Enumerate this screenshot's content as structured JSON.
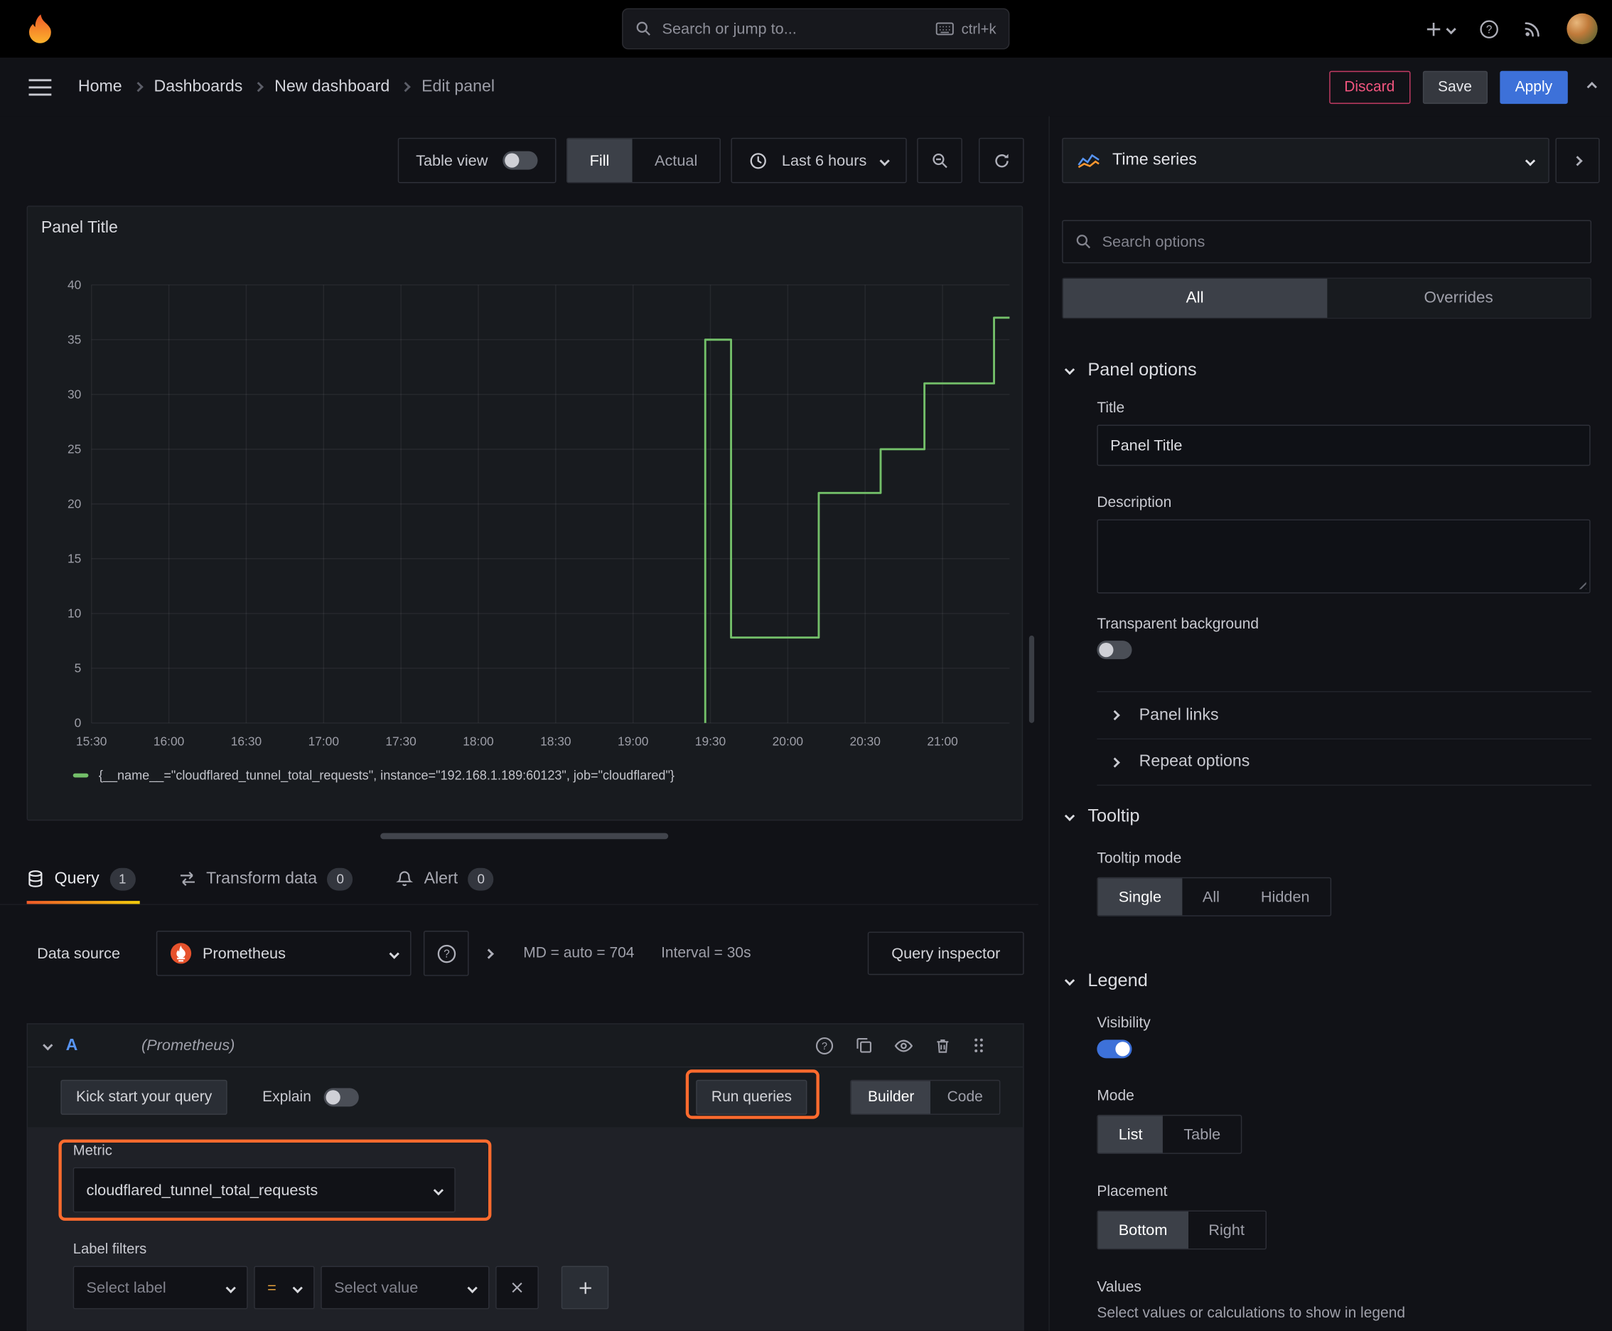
{
  "colors": {
    "accent_orange": "#ff780a",
    "annotation_highlight": "#ff6b2e",
    "primary_blue": "#3d71d9",
    "series_green": "#73bf69",
    "destructive_red": "#f2557f"
  },
  "topbar": {
    "search_placeholder": "Search or jump to...",
    "shortcut": "ctrl+k"
  },
  "breadcrumb": {
    "items": [
      "Home",
      "Dashboards",
      "New dashboard",
      "Edit panel"
    ],
    "discard_label": "Discard",
    "save_label": "Save",
    "apply_label": "Apply"
  },
  "panel_toolbar": {
    "table_view_label": "Table view",
    "table_view_on": false,
    "fill_label": "Fill",
    "actual_label": "Actual",
    "fill_selected": true,
    "time_range_label": "Last 6 hours"
  },
  "chart_data": {
    "type": "line",
    "title": "Panel Title",
    "x_ticks": [
      "15:30",
      "16:00",
      "16:30",
      "17:00",
      "17:30",
      "18:00",
      "18:30",
      "19:00",
      "19:30",
      "20:00",
      "20:30",
      "21:00"
    ],
    "x_tick_interval_min": 30,
    "x_range_minutes": [
      0,
      356
    ],
    "ylim": [
      0,
      40
    ],
    "y_ticks": [
      0,
      5,
      10,
      15,
      20,
      25,
      30,
      35,
      40
    ],
    "grid": true,
    "legend_position": "bottom",
    "series": [
      {
        "name": "{__name__=\"cloudflared_tunnel_total_requests\", instance=\"192.168.1.189:60123\", job=\"cloudflared\"}",
        "color": "#73bf69",
        "points_minutes_value": [
          [
            238,
            0
          ],
          [
            238,
            35
          ],
          [
            248,
            35
          ],
          [
            248,
            7.8
          ],
          [
            282,
            7.8
          ],
          [
            282,
            21
          ],
          [
            306,
            21
          ],
          [
            306,
            25
          ],
          [
            323,
            25
          ],
          [
            323,
            31
          ],
          [
            350,
            31
          ],
          [
            350,
            37
          ],
          [
            356,
            37
          ]
        ]
      }
    ]
  },
  "tabs": {
    "query_label": "Query",
    "query_count": "1",
    "transform_label": "Transform data",
    "transform_count": "0",
    "alert_label": "Alert",
    "alert_count": "0"
  },
  "query": {
    "datasource_label": "Data source",
    "datasource_value": "Prometheus",
    "stats_md": "MD = auto = 704",
    "stats_interval": "Interval = 30s",
    "inspector_label": "Query inspector",
    "ref_id": "A",
    "ref_note": "(Prometheus)",
    "kickstart_label": "Kick start your query",
    "explain_label": "Explain",
    "explain_on": false,
    "run_label": "Run queries",
    "builder_label": "Builder",
    "code_label": "Code",
    "builder_selected": true,
    "metric_label": "Metric",
    "metric_value": "cloudflared_tunnel_total_requests",
    "label_filters_label": "Label filters",
    "select_label_placeholder": "Select label",
    "operator_value": "=",
    "select_value_placeholder": "Select value"
  },
  "options": {
    "viz_label": "Time series",
    "search_placeholder": "Search options",
    "tab_all": "All",
    "tab_overrides": "Overrides",
    "selected_tab": "All",
    "panel_options": {
      "header": "Panel options",
      "title_label": "Title",
      "title_value": "Panel Title",
      "description_label": "Description",
      "transparent_label": "Transparent background",
      "transparent_on": false,
      "panel_links_label": "Panel links",
      "repeat_options_label": "Repeat options"
    },
    "tooltip": {
      "header": "Tooltip",
      "mode_label": "Tooltip mode",
      "modes": [
        "Single",
        "All",
        "Hidden"
      ],
      "selected_mode": "Single"
    },
    "legend": {
      "header": "Legend",
      "visibility_label": "Visibility",
      "visibility_on": true,
      "mode_label": "Mode",
      "modes": [
        "List",
        "Table"
      ],
      "selected_mode": "List",
      "placement_label": "Placement",
      "placements": [
        "Bottom",
        "Right"
      ],
      "selected_placement": "Bottom",
      "values_label": "Values",
      "values_help": "Select values or calculations to show in legend"
    }
  }
}
